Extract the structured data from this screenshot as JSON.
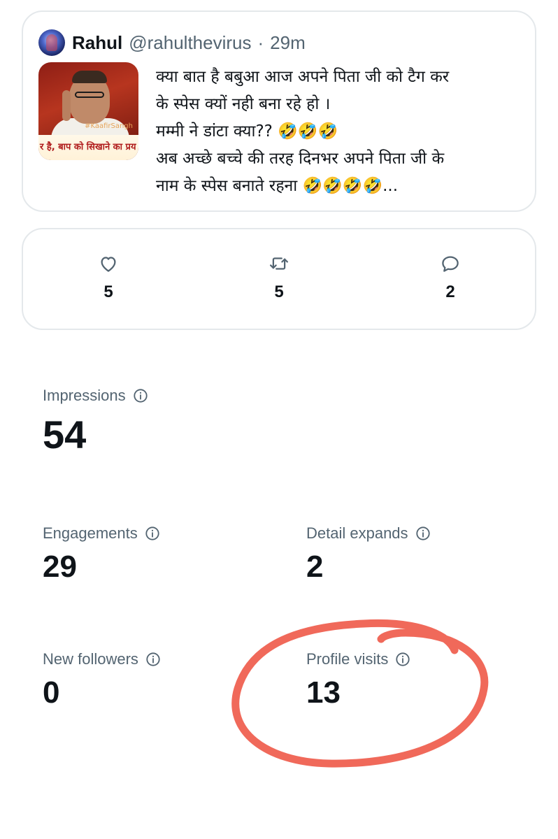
{
  "tweet": {
    "display_name": "Rahul",
    "handle": "@rahulthevirus",
    "separator": "·",
    "time": "29m",
    "media": {
      "caption": "र है, बाप को सिखाने का प्रय",
      "tag": "#KaafirSangh"
    },
    "text_lines": [
      "क्या बात है बबुआ आज अपने पिता जी को टैग कर",
      "के स्पेस क्यों नही बना रहे हो ।",
      "मम्मी ने डांटा क्या?? 🤣🤣🤣",
      "अब अच्छे बच्चे की तरह दिनभर अपने पिता जी के",
      "नाम के स्पेस बनाते रहना 🤣🤣🤣🤣..."
    ]
  },
  "actions": {
    "likes": "5",
    "retweets": "5",
    "replies": "2"
  },
  "metrics": {
    "impressions": {
      "label": "Impressions",
      "value": "54"
    },
    "engagements": {
      "label": "Engagements",
      "value": "29"
    },
    "detail_expands": {
      "label": "Detail expands",
      "value": "2"
    },
    "new_followers": {
      "label": "New followers",
      "value": "0"
    },
    "profile_visits": {
      "label": "Profile visits",
      "value": "13"
    }
  },
  "colors": {
    "text_primary": "#0f1419",
    "text_secondary": "#536471",
    "card_border": "#e4e8eb",
    "highlight": "#f0695a"
  },
  "icons": {
    "like": "heart-icon",
    "retweet": "retweet-icon",
    "reply": "reply-icon",
    "info": "info-icon"
  }
}
